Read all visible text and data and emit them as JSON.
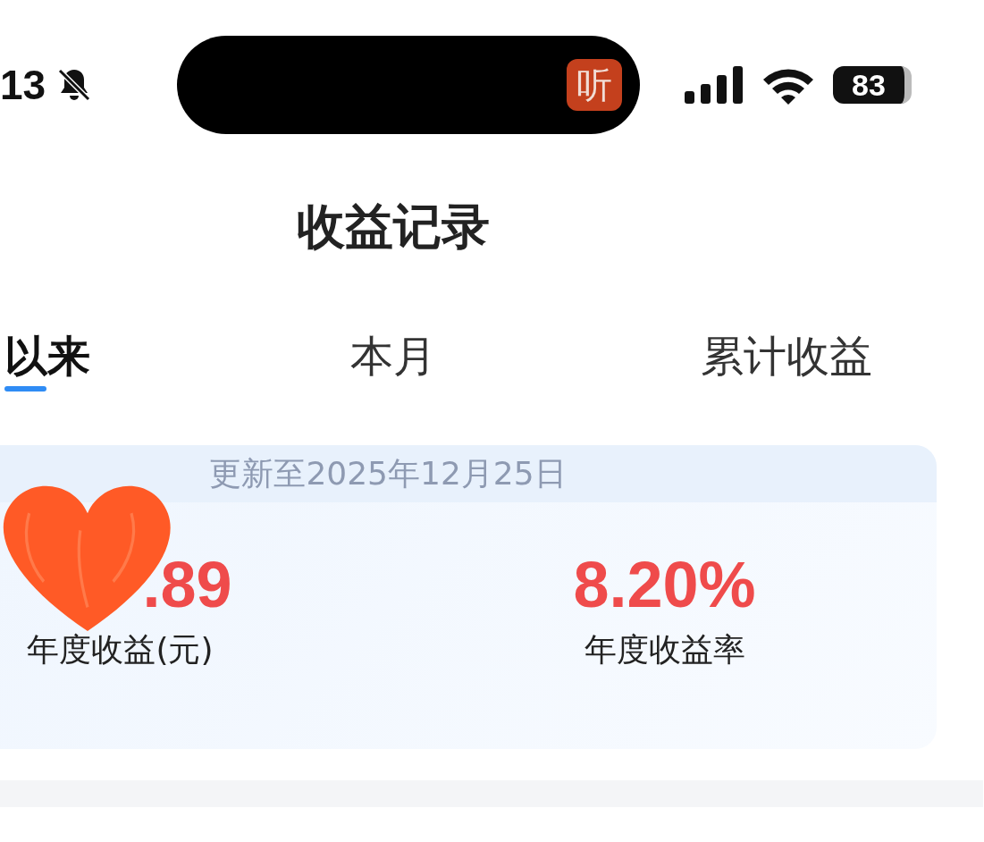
{
  "status_bar": {
    "time": "13",
    "app_badge": "听",
    "battery": "83"
  },
  "title": "收益记录",
  "tabs": [
    {
      "label": "以来",
      "selected": true
    },
    {
      "label": "本月",
      "selected": false
    },
    {
      "label": "累计收益",
      "selected": false
    }
  ],
  "card": {
    "updated": "更新至2025年12月25日",
    "stats": [
      {
        "value": ".89",
        "label": "年度收益(元)"
      },
      {
        "value": "8.20%",
        "label": "年度收益率"
      }
    ]
  },
  "overlay": {
    "kind": "heart"
  }
}
